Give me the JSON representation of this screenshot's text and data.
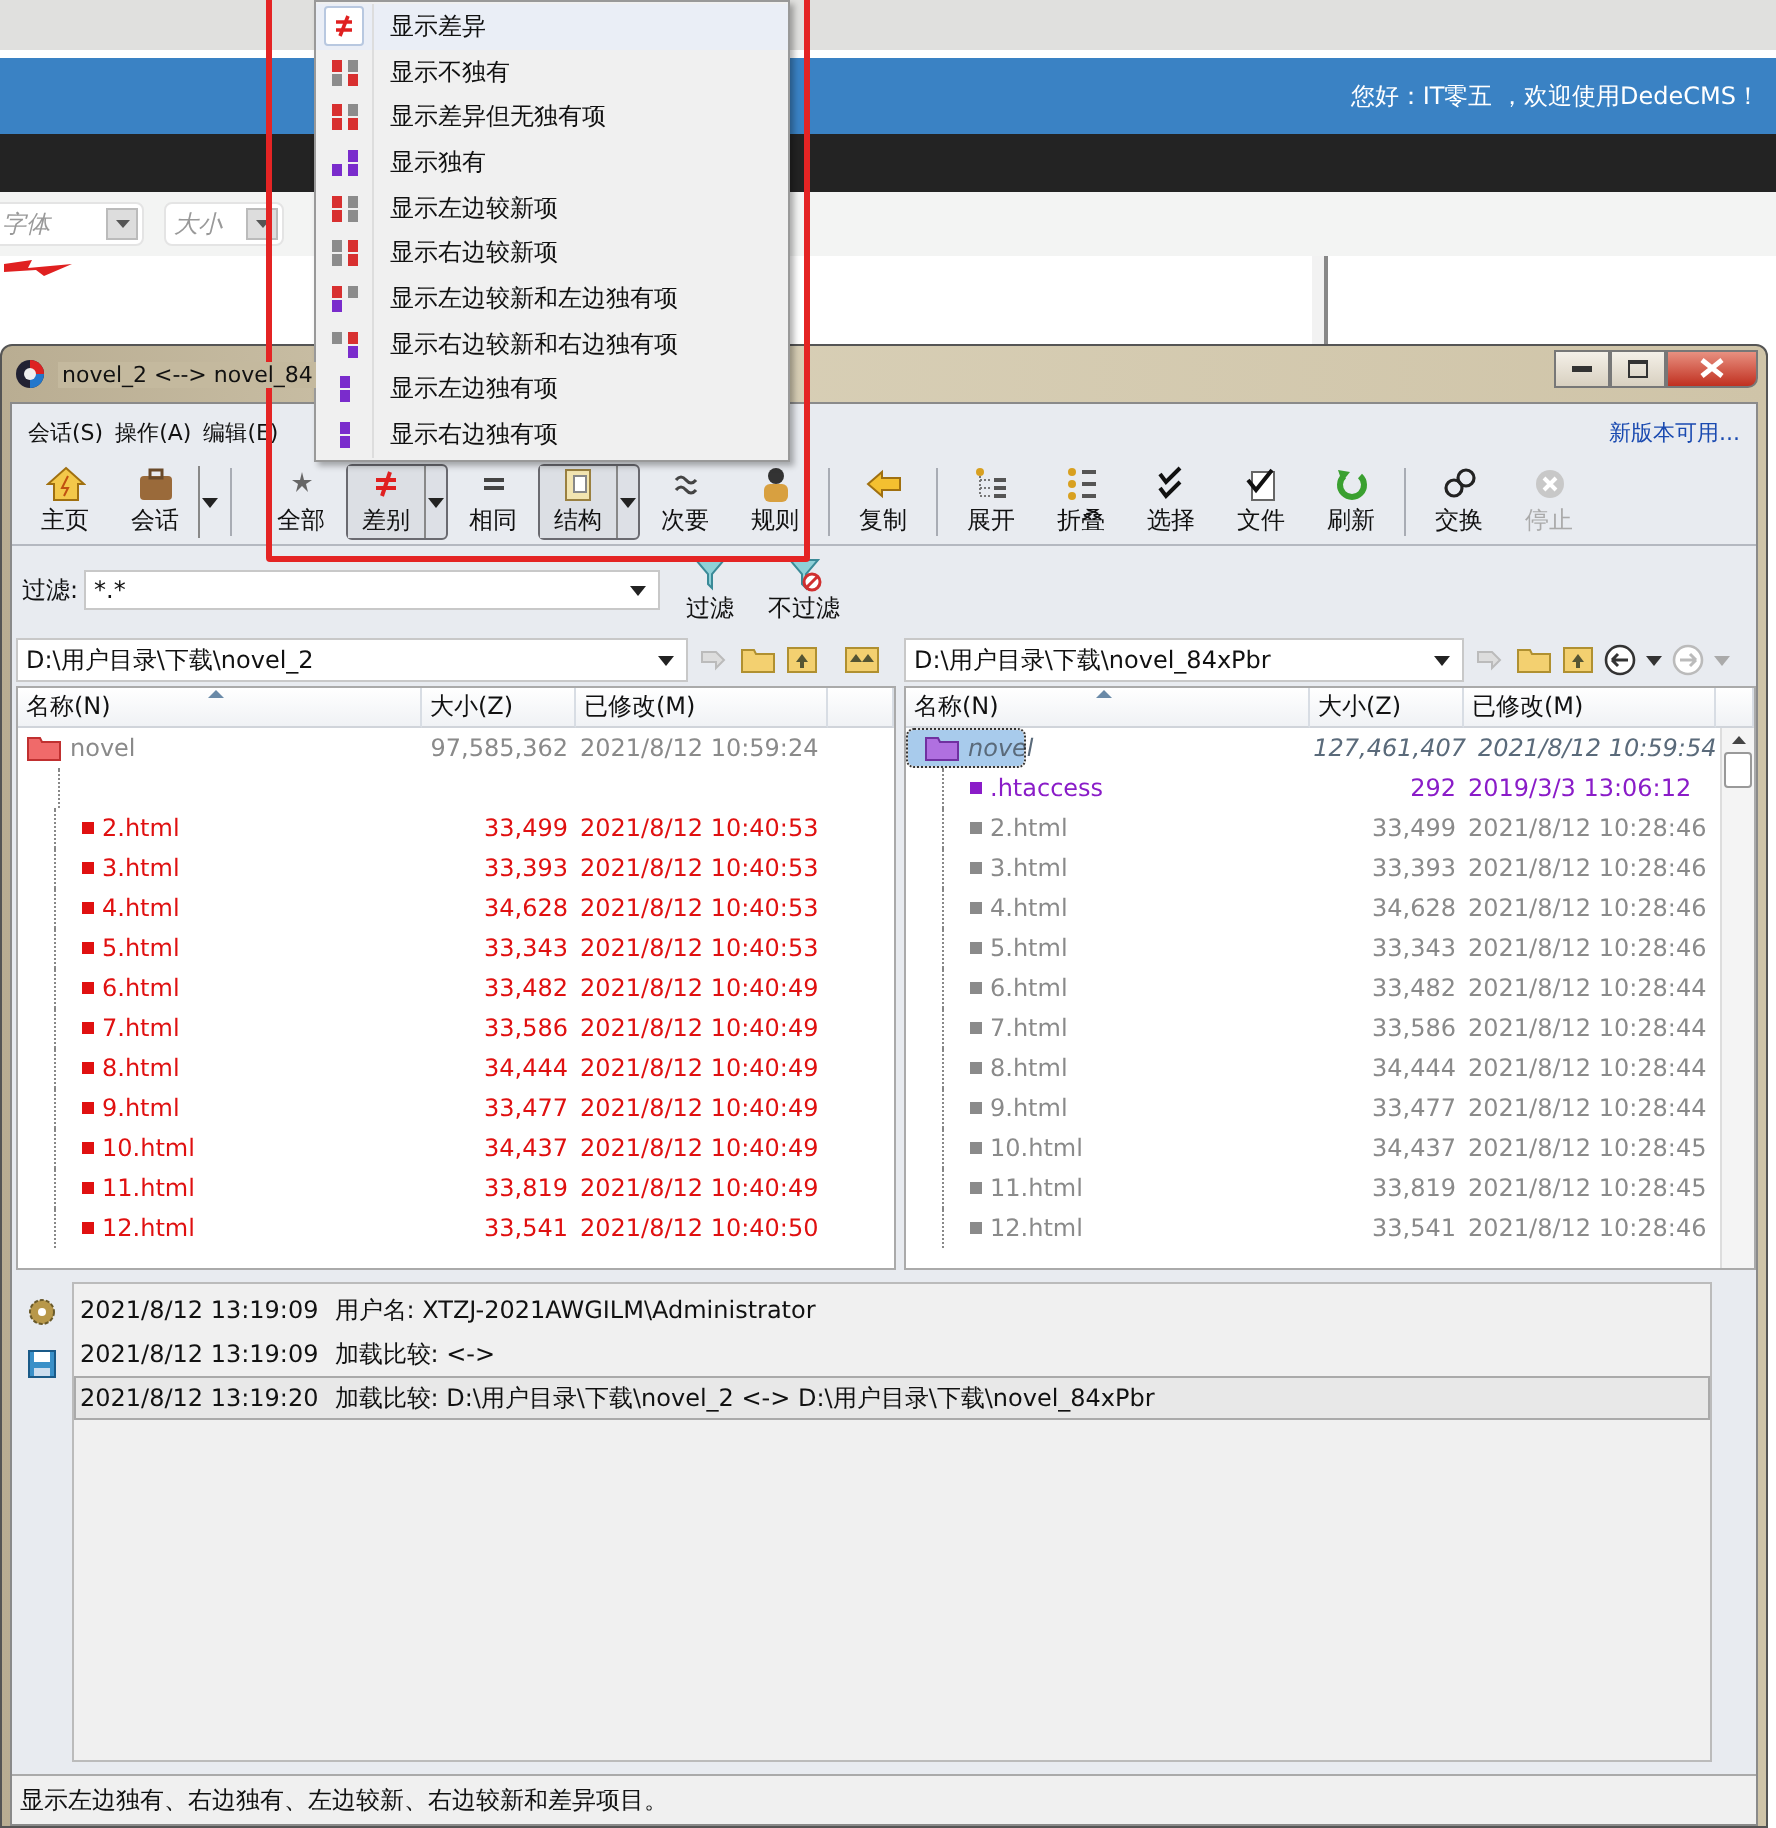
{
  "website": {
    "greeting": "您好：IT零五 ，欢迎使用DedeCMS！",
    "font_select": {
      "placeholder": "字体"
    },
    "size_select": {
      "placeholder": "大小"
    }
  },
  "window": {
    "title": "novel_2 <--> novel_84"
  },
  "menu_bar": {
    "items": [
      "会话(S)",
      "操作(A)",
      "编辑(E)"
    ],
    "update_link": "新版本可用..."
  },
  "toolbar": [
    {
      "kind": "button",
      "label": "主页",
      "selected": false,
      "dropdown": false,
      "disabled": false
    },
    {
      "kind": "button",
      "label": "会话",
      "selected": false,
      "dropdown": true,
      "disabled": false
    },
    {
      "kind": "separator"
    },
    {
      "kind": "button",
      "label": "全部",
      "selected": false,
      "dropdown": false,
      "disabled": false
    },
    {
      "kind": "button",
      "label": "差别",
      "selected": true,
      "dropdown": true,
      "disabled": false
    },
    {
      "kind": "button",
      "label": "相同",
      "selected": false,
      "dropdown": false,
      "disabled": false
    },
    {
      "kind": "button",
      "label": "结构",
      "selected": true,
      "dropdown": true,
      "disabled": false
    },
    {
      "kind": "button",
      "label": "次要",
      "selected": false,
      "dropdown": false,
      "disabled": false
    },
    {
      "kind": "button",
      "label": "规则",
      "selected": false,
      "dropdown": false,
      "disabled": false
    },
    {
      "kind": "separator"
    },
    {
      "kind": "button",
      "label": "复制",
      "selected": false,
      "dropdown": false,
      "disabled": false
    },
    {
      "kind": "separator"
    },
    {
      "kind": "button",
      "label": "展开",
      "selected": false,
      "dropdown": false,
      "disabled": false
    },
    {
      "kind": "button",
      "label": "折叠",
      "selected": false,
      "dropdown": false,
      "disabled": false
    },
    {
      "kind": "button",
      "label": "选择",
      "selected": false,
      "dropdown": false,
      "disabled": false
    },
    {
      "kind": "button",
      "label": "文件",
      "selected": false,
      "dropdown": false,
      "disabled": false
    },
    {
      "kind": "button",
      "label": "刷新",
      "selected": false,
      "dropdown": false,
      "disabled": false
    },
    {
      "kind": "separator"
    },
    {
      "kind": "button",
      "label": "交换",
      "selected": false,
      "dropdown": false,
      "disabled": false
    },
    {
      "kind": "button",
      "label": "停止",
      "selected": false,
      "dropdown": false,
      "disabled": true
    }
  ],
  "filter": {
    "label": "过滤:",
    "value": "*.*",
    "buttons": [
      {
        "label": "过滤"
      },
      {
        "label": "不过滤"
      }
    ]
  },
  "panes": [
    {
      "path": "D:\\用户目录\\下载\\novel_2",
      "columns": [
        "名称(N)",
        "大小(Z)",
        "已修改(M)"
      ],
      "rows": [
        {
          "kind": "folder",
          "name": "novel",
          "size": "97,585,362",
          "modified": "2021/8/12 10:59:24",
          "selected": false,
          "children": [
            {
              "kind": "blank"
            },
            {
              "kind": "newer",
              "name": "2.html",
              "size": "33,499",
              "modified": "2021/8/12 10:40:53",
              "selected": false
            },
            {
              "kind": "newer",
              "name": "3.html",
              "size": "33,393",
              "modified": "2021/8/12 10:40:53",
              "selected": false
            },
            {
              "kind": "newer",
              "name": "4.html",
              "size": "34,628",
              "modified": "2021/8/12 10:40:53",
              "selected": false
            },
            {
              "kind": "newer",
              "name": "5.html",
              "size": "33,343",
              "modified": "2021/8/12 10:40:53",
              "selected": false
            },
            {
              "kind": "newer",
              "name": "6.html",
              "size": "33,482",
              "modified": "2021/8/12 10:40:49",
              "selected": false
            },
            {
              "kind": "newer",
              "name": "7.html",
              "size": "33,586",
              "modified": "2021/8/12 10:40:49",
              "selected": false
            },
            {
              "kind": "newer",
              "name": "8.html",
              "size": "34,444",
              "modified": "2021/8/12 10:40:49",
              "selected": false
            },
            {
              "kind": "newer",
              "name": "9.html",
              "size": "33,477",
              "modified": "2021/8/12 10:40:49",
              "selected": false
            },
            {
              "kind": "newer",
              "name": "10.html",
              "size": "34,437",
              "modified": "2021/8/12 10:40:49",
              "selected": false
            },
            {
              "kind": "newer",
              "name": "11.html",
              "size": "33,819",
              "modified": "2021/8/12 10:40:49",
              "selected": false
            },
            {
              "kind": "newer",
              "name": "12.html",
              "size": "33,541",
              "modified": "2021/8/12 10:40:50",
              "selected": false
            }
          ]
        }
      ]
    },
    {
      "path": "D:\\用户目录\\下载\\novel_84xPbr",
      "columns": [
        "名称(N)",
        "大小(Z)",
        "已修改(M)"
      ],
      "rows": [
        {
          "kind": "folder",
          "name": "novel",
          "size": "127,461,407",
          "modified": "2021/8/12 10:59:54",
          "selected": true,
          "children": [
            {
              "kind": "orphan",
              "name": ".htaccess",
              "size": "292",
              "modified": "2019/3/3 13:06:12",
              "selected": false
            },
            {
              "kind": "older",
              "name": "2.html",
              "size": "33,499",
              "modified": "2021/8/12 10:28:46",
              "selected": false
            },
            {
              "kind": "older",
              "name": "3.html",
              "size": "33,393",
              "modified": "2021/8/12 10:28:46",
              "selected": false
            },
            {
              "kind": "older",
              "name": "4.html",
              "size": "34,628",
              "modified": "2021/8/12 10:28:46",
              "selected": false
            },
            {
              "kind": "older",
              "name": "5.html",
              "size": "33,343",
              "modified": "2021/8/12 10:28:46",
              "selected": false
            },
            {
              "kind": "older",
              "name": "6.html",
              "size": "33,482",
              "modified": "2021/8/12 10:28:44",
              "selected": false
            },
            {
              "kind": "older",
              "name": "7.html",
              "size": "33,586",
              "modified": "2021/8/12 10:28:44",
              "selected": false
            },
            {
              "kind": "older",
              "name": "8.html",
              "size": "34,444",
              "modified": "2021/8/12 10:28:44",
              "selected": false
            },
            {
              "kind": "older",
              "name": "9.html",
              "size": "33,477",
              "modified": "2021/8/12 10:28:44",
              "selected": false
            },
            {
              "kind": "older",
              "name": "10.html",
              "size": "34,437",
              "modified": "2021/8/12 10:28:45",
              "selected": false
            },
            {
              "kind": "older",
              "name": "11.html",
              "size": "33,819",
              "modified": "2021/8/12 10:28:45",
              "selected": false
            },
            {
              "kind": "older",
              "name": "12.html",
              "size": "33,541",
              "modified": "2021/8/12 10:28:46",
              "selected": false
            }
          ]
        }
      ]
    }
  ],
  "log": [
    {
      "time": "2021/8/12 13:19:09",
      "message": "用户名: XTZJ-2021AWGILM\\Administrator",
      "selected": false
    },
    {
      "time": "2021/8/12 13:19:09",
      "message": "加载比较:  <->",
      "selected": false
    },
    {
      "time": "2021/8/12 13:19:20",
      "message": "加载比较: D:\\用户目录\\下载\\novel_2 <-> D:\\用户目录\\下载\\novel_84xPbr",
      "selected": true
    }
  ],
  "status_bar": "显示左边独有、右边独有、左边较新、右边较新和差异项目。",
  "filter_menu": [
    {
      "label": "显示差异",
      "selected": true
    },
    {
      "label": "显示不独有",
      "selected": false
    },
    {
      "label": "显示差异但无独有项",
      "selected": false
    },
    {
      "label": "显示独有",
      "selected": false
    },
    {
      "label": "显示左边较新项",
      "selected": false
    },
    {
      "label": "显示右边较新项",
      "selected": false
    },
    {
      "label": "显示左边较新和左边独有项",
      "selected": false
    },
    {
      "label": "显示右边较新和右边独有项",
      "selected": false
    },
    {
      "label": "显示左边独有项",
      "selected": false
    },
    {
      "label": "显示右边独有项",
      "selected": false
    }
  ]
}
